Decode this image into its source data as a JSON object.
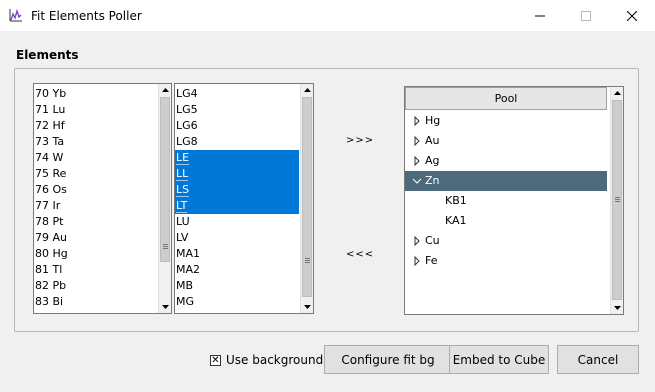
{
  "window": {
    "title": "Fit Elements Poller"
  },
  "group": {
    "label": "Elements"
  },
  "elements_list": {
    "items": [
      "70 Yb",
      "71 Lu",
      "72 Hf",
      "73 Ta",
      "74 W",
      "75 Re",
      "76 Os",
      "77 Ir",
      "78 Pt",
      "79 Au",
      "80 Hg",
      "81 Tl",
      "82 Pb",
      "83 Bi"
    ]
  },
  "lines_list": {
    "items": [
      {
        "label": "LG4",
        "selected": false
      },
      {
        "label": "LG5",
        "selected": false
      },
      {
        "label": "LG6",
        "selected": false
      },
      {
        "label": "LG8",
        "selected": false
      },
      {
        "label": "LE",
        "selected": true
      },
      {
        "label": "LL",
        "selected": true
      },
      {
        "label": "LS",
        "selected": true
      },
      {
        "label": "LT",
        "selected": true
      },
      {
        "label": "LU",
        "selected": false
      },
      {
        "label": "LV",
        "selected": false
      },
      {
        "label": "MA1",
        "selected": false
      },
      {
        "label": "MA2",
        "selected": false
      },
      {
        "label": "MB",
        "selected": false
      },
      {
        "label": "MG",
        "selected": false
      }
    ]
  },
  "move": {
    "add_label": ">>>",
    "remove_label": "<<<"
  },
  "pool": {
    "header": "Pool",
    "nodes": [
      {
        "label": "Hg",
        "expanded": false,
        "selected": false,
        "children": []
      },
      {
        "label": "Au",
        "expanded": false,
        "selected": false,
        "children": []
      },
      {
        "label": "Ag",
        "expanded": false,
        "selected": false,
        "children": []
      },
      {
        "label": "Zn",
        "expanded": true,
        "selected": true,
        "children": [
          "KB1",
          "KA1"
        ]
      },
      {
        "label": "Cu",
        "expanded": false,
        "selected": false,
        "children": []
      },
      {
        "label": "Fe",
        "expanded": false,
        "selected": false,
        "children": []
      }
    ]
  },
  "footer": {
    "use_background_label": "Use background",
    "use_background_checked": true,
    "configure_label": "Configure fit bg",
    "embed_label": "Embed to Cube",
    "cancel_label": "Cancel"
  },
  "colors": {
    "selection": "#0078d7",
    "tree_selection": "#4d6a7c"
  }
}
